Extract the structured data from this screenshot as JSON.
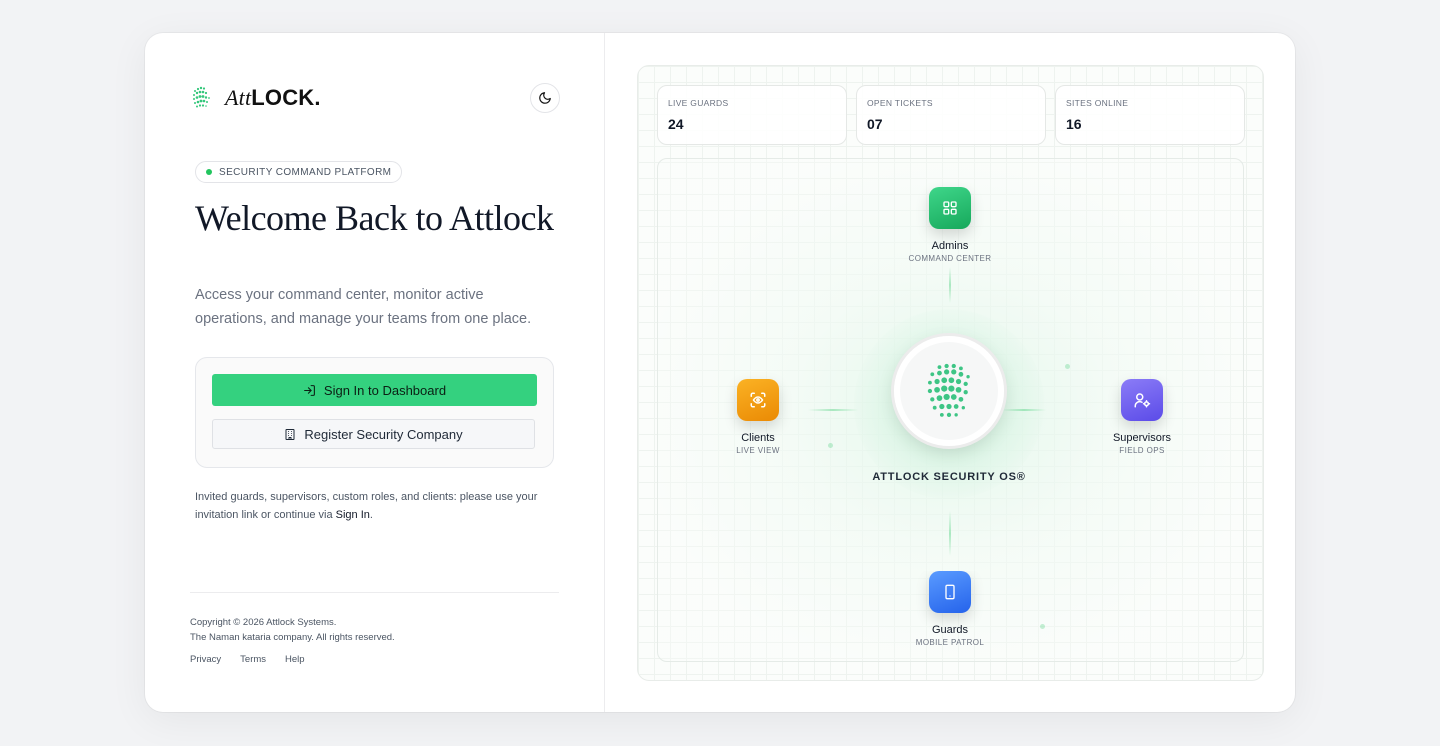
{
  "brand": {
    "logo_italic": "Att",
    "logo_bold": "LOCK."
  },
  "badge": "SECURITY COMMAND PLATFORM",
  "hero": {
    "title": "Welcome Back to Attlock",
    "subtitle": "Access your command center, monitor active operations, and manage your teams from one place."
  },
  "actions": {
    "sign_in": "Sign In to Dashboard",
    "register": "Register Security Company"
  },
  "note": {
    "text": "Invited guards, supervisors, custom roles, and clients: please use your invitation link or continue via",
    "link": "Sign In",
    "end": "."
  },
  "footer": {
    "copyright_line1": "Copyright © 2026 Attlock Systems.",
    "copyright_line2": "The Naman kataria company. All rights reserved.",
    "links": [
      "Privacy",
      "Terms",
      "Help"
    ]
  },
  "stats": [
    {
      "label": "LIVE GUARDS",
      "value": "24"
    },
    {
      "label": "OPEN TICKETS",
      "value": "07"
    },
    {
      "label": "SITES ONLINE",
      "value": "16"
    }
  ],
  "hub_label": "ATTLOCK SECURITY OS®",
  "nodes": {
    "admins": {
      "title": "Admins",
      "sub": "COMMAND CENTER",
      "color": "#22c06a"
    },
    "clients": {
      "title": "Clients",
      "sub": "LIVE VIEW",
      "color": "#f59e0b"
    },
    "supervisors": {
      "title": "Supervisors",
      "sub": "FIELD OPS",
      "color": "#6366f1"
    },
    "guards": {
      "title": "Guards",
      "sub": "MOBILE PATROL",
      "color": "#3b82f6"
    }
  },
  "icons": {
    "logo": "globe-mesh-icon",
    "theme": "moon-icon",
    "sign_in": "login-arrow-icon",
    "register": "building-icon"
  }
}
